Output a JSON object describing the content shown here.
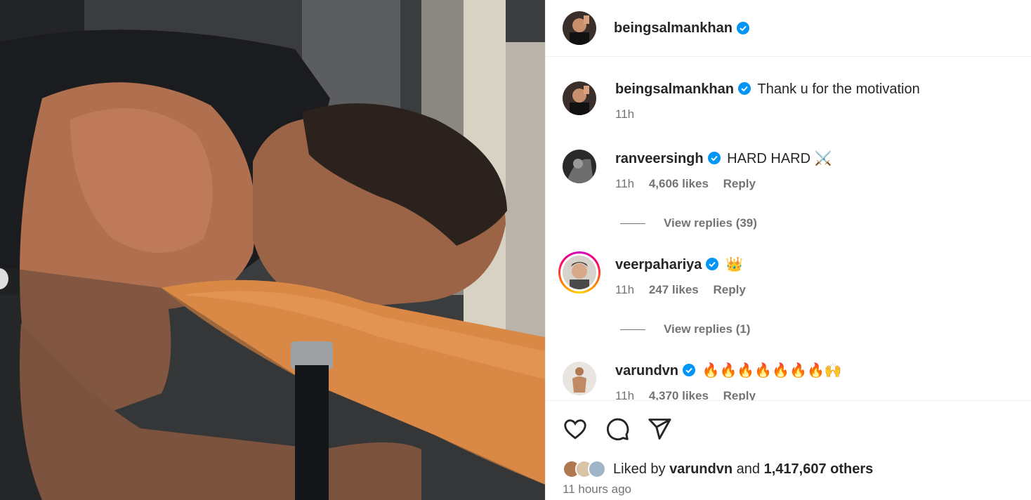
{
  "post": {
    "author": "beingsalmankhan",
    "caption": "Thank u for the motivation",
    "caption_time": "11h",
    "liked_by_user": "varundvn",
    "liked_by_others": "1,417,607 others",
    "liked_prefix": "Liked by",
    "liked_and": "and",
    "time_ago": "11 hours ago"
  },
  "comments": [
    {
      "user": "ranveersingh",
      "text": "HARD HARD ⚔️",
      "time": "11h",
      "likes": "4,606 likes",
      "reply": "Reply",
      "view_replies": "View replies (39)"
    },
    {
      "user": "veerpahariya",
      "text": "👑",
      "time": "11h",
      "likes": "247 likes",
      "reply": "Reply",
      "view_replies": "View replies (1)"
    },
    {
      "user": "varundvn",
      "text": "🔥🔥🔥🔥🔥🔥🔥🙌",
      "time": "11h",
      "likes": "4,370 likes",
      "reply": "Reply"
    }
  ],
  "icons": {
    "like": "heart-icon",
    "comment": "comment-icon",
    "share": "share-icon",
    "verified": "verified-badge-icon"
  },
  "colors": {
    "verified": "#0095f6",
    "secondary_text": "#737373",
    "divider": "#efefef"
  }
}
